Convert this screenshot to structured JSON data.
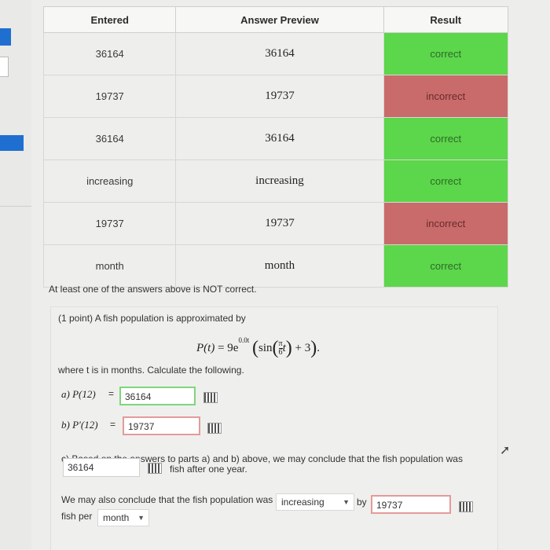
{
  "table": {
    "headers": [
      "Entered",
      "Answer Preview",
      "Result"
    ],
    "rows": [
      {
        "entered": "36164",
        "preview": "36164",
        "result": "correct"
      },
      {
        "entered": "19737",
        "preview": "19737",
        "result": "incorrect"
      },
      {
        "entered": "36164",
        "preview": "36164",
        "result": "correct"
      },
      {
        "entered": "increasing",
        "preview": "increasing",
        "result": "correct"
      },
      {
        "entered": "19737",
        "preview": "19737",
        "result": "incorrect"
      },
      {
        "entered": "month",
        "preview": "month",
        "result": "correct"
      }
    ]
  },
  "notice": "At least one of the answers above is NOT correct.",
  "problem": {
    "intro": "(1 point) A fish population is approximated by",
    "formula": {
      "lhs": "P(t)",
      "coef": "9e",
      "exp": "0.0t",
      "sin": "sin",
      "fn": "π",
      "fd": "6",
      "tail": "t",
      "plus": "+ 3"
    },
    "where": "where t is in months. Calculate the following.",
    "a_label": "a) P(12)",
    "a_value": "36164",
    "b_label": "b) P′(12)",
    "b_value": "19737",
    "c_text": "c) Based on the answers to parts a) and b) above, we may conclude that the fish population was",
    "c_value": "36164",
    "c_after": "fish after one year.",
    "d_text": "We may also conclude that the fish population was",
    "d_select": "increasing",
    "d_by": "by",
    "d_value": "19737",
    "d_per": "fish per",
    "d_unit": "month"
  }
}
